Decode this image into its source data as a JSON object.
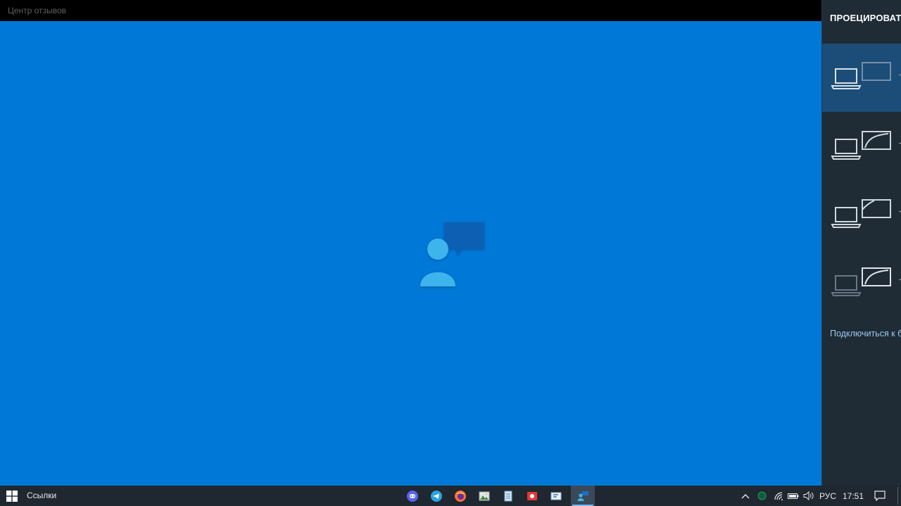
{
  "window": {
    "title": "Центр отзывов"
  },
  "app": {
    "splash_icon": "feedback-hub-person-icon",
    "colors": {
      "background": "#0078d7",
      "person": "#3eb4ec",
      "bubble": "#0a5fb4"
    }
  },
  "project_panel": {
    "title": "ПРОЕЦИРОВАТЬ",
    "options": [
      {
        "icon": "pc-screen-only-icon",
        "selected": true
      },
      {
        "icon": "duplicate-icon",
        "selected": false
      },
      {
        "icon": "extend-icon",
        "selected": false
      },
      {
        "icon": "second-screen-only-icon",
        "selected": false
      }
    ],
    "connect_link": "Подключиться к беспроводному дисплею"
  },
  "taskbar": {
    "links_label": "Ссылки",
    "apps": [
      {
        "name": "discord-icon",
        "active": false
      },
      {
        "name": "telegram-icon",
        "active": false
      },
      {
        "name": "firefox-icon",
        "active": false
      },
      {
        "name": "photo-viewer-icon",
        "active": false
      },
      {
        "name": "notepad-icon",
        "active": false
      },
      {
        "name": "screen-recorder-icon",
        "active": false
      },
      {
        "name": "text-editor-icon",
        "active": false
      },
      {
        "name": "feedback-hub-icon",
        "active": true
      }
    ],
    "tray": {
      "language": "РУС",
      "time": "17:51"
    }
  }
}
